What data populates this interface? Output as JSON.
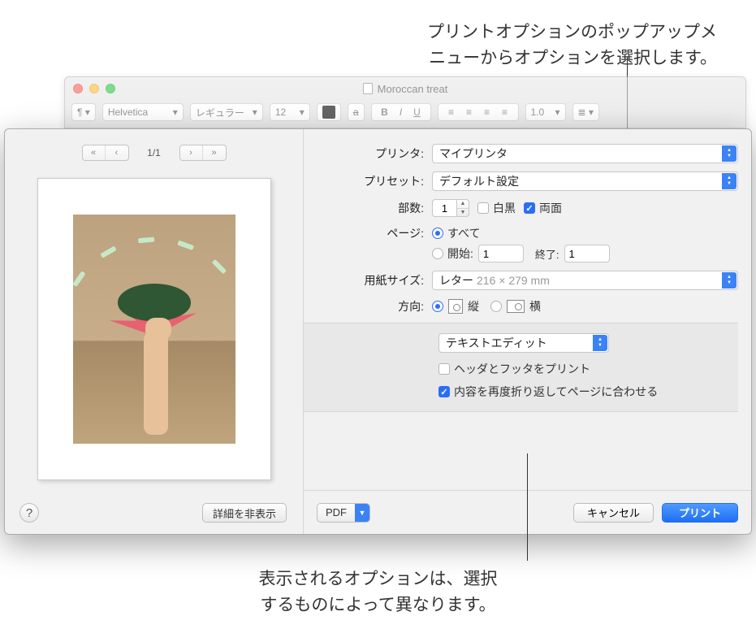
{
  "annotations": {
    "top": "プリントオプションのポップアップメ\nニューからオプションを選択します。",
    "bottom": "表示されるオプションは、選択\nするものによって異なります。"
  },
  "app_window": {
    "title": "Moroccan treat",
    "toolbar": {
      "font": "Helvetica",
      "style": "レギュラー",
      "size": "12",
      "line_spacing": "1.0"
    }
  },
  "preview": {
    "page_indicator": "1/1",
    "details_button": "詳細を非表示"
  },
  "labels": {
    "printer": "プリンタ:",
    "presets": "プリセット:",
    "copies": "部数:",
    "bw": "白黒",
    "duplex": "両面",
    "pages": "ページ:",
    "all": "すべて",
    "from": "開始:",
    "to": "終了:",
    "paper_size": "用紙サイズ:",
    "orientation": "方向:",
    "portrait": "縦",
    "landscape": "横"
  },
  "values": {
    "printer": "マイプリンタ",
    "preset": "デフォルト設定",
    "copies": "1",
    "bw_checked": false,
    "duplex_checked": true,
    "pages_all": true,
    "from": "1",
    "to": "1",
    "paper_size": "レター",
    "paper_dim": "216 × 279 mm",
    "orientation_portrait": true
  },
  "app_options": {
    "popup": "テキストエディット",
    "header_footer": "ヘッダとフッタをプリント",
    "header_footer_checked": false,
    "rewrap": "内容を再度折り返してページに合わせる",
    "rewrap_checked": true
  },
  "bottom": {
    "pdf": "PDF",
    "cancel": "キャンセル",
    "print": "プリント"
  }
}
